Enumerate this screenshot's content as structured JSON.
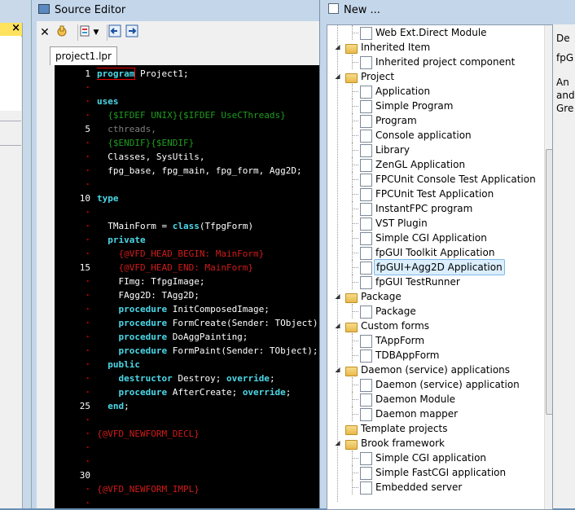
{
  "left_window": {
    "close_glyph": "×"
  },
  "source_editor": {
    "title": "Source Editor",
    "close_glyph": "✕",
    "tab": "project1.lpr",
    "gutter": [
      "1",
      "·",
      "·",
      "·",
      "5",
      "·",
      "·",
      "·",
      "·",
      "10",
      "·",
      "·",
      "·",
      "·",
      "15",
      "·",
      "·",
      "·",
      "·",
      "·",
      "·",
      "·",
      "·",
      "·",
      "25",
      "·",
      "·",
      "·",
      "·",
      "30",
      "·",
      "·"
    ],
    "lines": [
      [
        {
          "c": "k boxed",
          "t": "program"
        },
        {
          "c": "t",
          "t": " Project1;"
        }
      ],
      [],
      [
        {
          "c": "k",
          "t": "uses"
        }
      ],
      [
        {
          "c": "g",
          "t": "  {$IFDEF UNIX}"
        },
        {
          "c": "g",
          "t": "{$IFDEF UseCThreads}"
        }
      ],
      [
        {
          "c": "gr",
          "t": "  cthreads,"
        }
      ],
      [
        {
          "c": "g",
          "t": "  {$ENDIF}"
        },
        {
          "c": "g",
          "t": "{$ENDIF}"
        }
      ],
      [
        {
          "c": "t",
          "t": "  Classes, SysUtils,"
        }
      ],
      [
        {
          "c": "t",
          "t": "  fpg_base, fpg_main, fpg_form, Agg2D;"
        }
      ],
      [],
      [
        {
          "c": "k",
          "t": "type"
        }
      ],
      [],
      [
        {
          "c": "t",
          "t": "  TMainForm = "
        },
        {
          "c": "k",
          "t": "class"
        },
        {
          "c": "t",
          "t": "(TfpgForm)"
        }
      ],
      [
        {
          "c": "k",
          "t": "  private"
        }
      ],
      [
        {
          "c": "r",
          "t": "    {@VFD_HEAD_BEGIN: MainForm}"
        }
      ],
      [
        {
          "c": "r",
          "t": "    {@VFD_HEAD_END: MainForm}"
        }
      ],
      [
        {
          "c": "t",
          "t": "    FImg: TfpgImage;"
        }
      ],
      [
        {
          "c": "t",
          "t": "    FAgg2D: TAgg2D;"
        }
      ],
      [
        {
          "c": "k",
          "t": "    procedure"
        },
        {
          "c": "t",
          "t": " InitComposedImage;"
        }
      ],
      [
        {
          "c": "k",
          "t": "    procedure"
        },
        {
          "c": "t",
          "t": " FormCreate(Sender: TObject);"
        }
      ],
      [
        {
          "c": "k",
          "t": "    procedure"
        },
        {
          "c": "t",
          "t": " DoAggPainting;"
        }
      ],
      [
        {
          "c": "k",
          "t": "    procedure"
        },
        {
          "c": "t",
          "t": " FormPaint(Sender: TObject);"
        }
      ],
      [
        {
          "c": "k",
          "t": "  public"
        }
      ],
      [
        {
          "c": "k",
          "t": "    destructor"
        },
        {
          "c": "t",
          "t": " Destroy; "
        },
        {
          "c": "k",
          "t": "override"
        },
        {
          "c": "t",
          "t": ";"
        }
      ],
      [
        {
          "c": "k",
          "t": "    procedure"
        },
        {
          "c": "t",
          "t": " AfterCreate; "
        },
        {
          "c": "k",
          "t": "override"
        },
        {
          "c": "t",
          "t": ";"
        }
      ],
      [
        {
          "c": "k",
          "t": "  end"
        },
        {
          "c": "t",
          "t": ";"
        }
      ],
      [],
      [
        {
          "c": "r",
          "t": "{@VFD_NEWFORM_DECL}"
        }
      ],
      [],
      [],
      [],
      [
        {
          "c": "r",
          "t": "{@VFD_NEWFORM_IMPL}"
        }
      ],
      []
    ]
  },
  "new_dialog": {
    "title": "New ...",
    "tree": [
      {
        "label": "Web Ext.Direct Module",
        "level": 1,
        "kind": "doc"
      },
      {
        "label": "Inherited Item",
        "level": 0,
        "kind": "folder"
      },
      {
        "label": "Inherited project component",
        "level": 1,
        "kind": "doc"
      },
      {
        "label": "Project",
        "level": 0,
        "kind": "folder"
      },
      {
        "label": "Application",
        "level": 1,
        "kind": "doc"
      },
      {
        "label": "Simple Program",
        "level": 1,
        "kind": "doc"
      },
      {
        "label": "Program",
        "level": 1,
        "kind": "doc"
      },
      {
        "label": "Console application",
        "level": 1,
        "kind": "doc"
      },
      {
        "label": "Library",
        "level": 1,
        "kind": "doc"
      },
      {
        "label": "ZenGL Application",
        "level": 1,
        "kind": "doc"
      },
      {
        "label": "FPCUnit Console Test Application",
        "level": 1,
        "kind": "doc"
      },
      {
        "label": "FPCUnit Test Application",
        "level": 1,
        "kind": "doc"
      },
      {
        "label": "InstantFPC program",
        "level": 1,
        "kind": "doc"
      },
      {
        "label": "VST Plugin",
        "level": 1,
        "kind": "doc"
      },
      {
        "label": "Simple CGI Application",
        "level": 1,
        "kind": "doc"
      },
      {
        "label": "fpGUI Toolkit Application",
        "level": 1,
        "kind": "doc"
      },
      {
        "label": "fpGUI+Agg2D Application",
        "level": 1,
        "kind": "doc",
        "selected": true
      },
      {
        "label": "fpGUI TestRunner",
        "level": 1,
        "kind": "doc"
      },
      {
        "label": "Package",
        "level": 0,
        "kind": "folder"
      },
      {
        "label": "Package",
        "level": 1,
        "kind": "doc"
      },
      {
        "label": "Custom forms",
        "level": 0,
        "kind": "folder"
      },
      {
        "label": "TAppForm",
        "level": 1,
        "kind": "doc"
      },
      {
        "label": "TDBAppForm",
        "level": 1,
        "kind": "doc"
      },
      {
        "label": "Daemon (service) applications",
        "level": 0,
        "kind": "folder"
      },
      {
        "label": "Daemon (service) application",
        "level": 1,
        "kind": "doc"
      },
      {
        "label": "Daemon Module",
        "level": 1,
        "kind": "doc"
      },
      {
        "label": "Daemon mapper",
        "level": 1,
        "kind": "doc"
      },
      {
        "label": "Template projects",
        "level": 0,
        "kind": "folder",
        "noexp": true
      },
      {
        "label": "Brook framework",
        "level": 0,
        "kind": "folder"
      },
      {
        "label": "Simple CGI application",
        "level": 1,
        "kind": "doc"
      },
      {
        "label": "Simple FastCGI application",
        "level": 1,
        "kind": "doc"
      },
      {
        "label": "Embedded server",
        "level": 1,
        "kind": "doc"
      }
    ],
    "side_texts": [
      "De",
      "fpG",
      "An",
      "and",
      "Gre"
    ]
  }
}
